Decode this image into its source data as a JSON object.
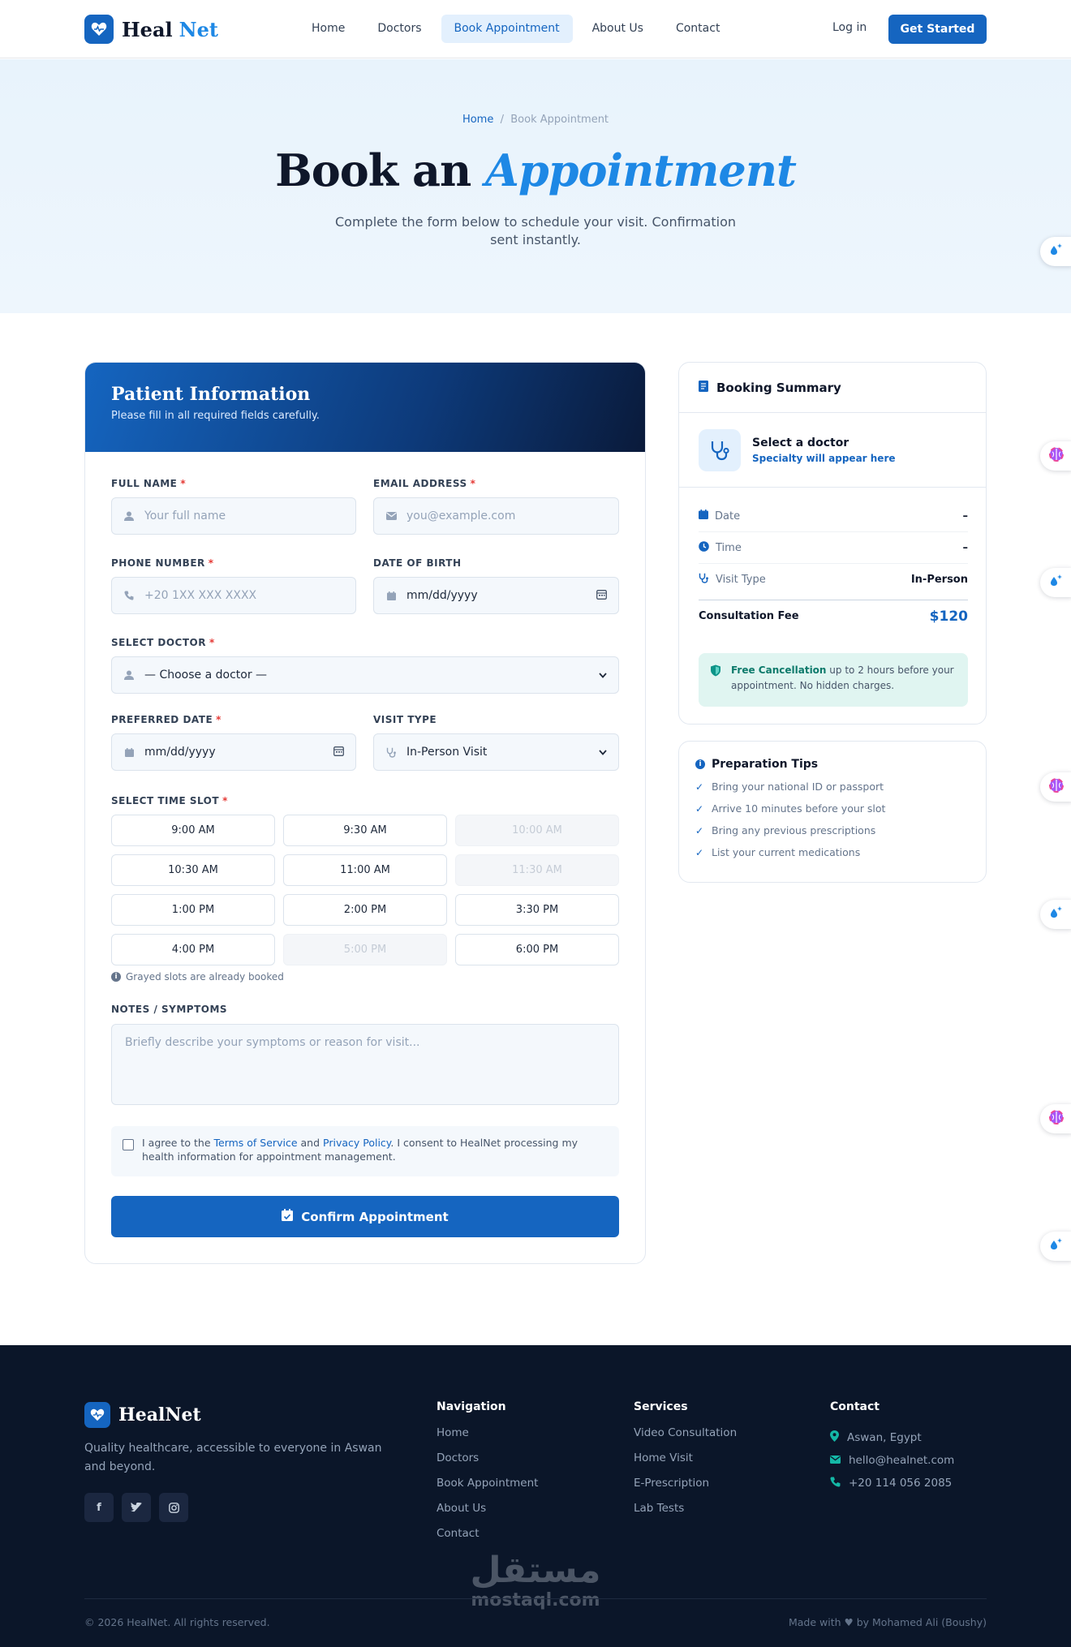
{
  "brand": {
    "name_part1": "Heal",
    "name_part2": "Net",
    "footer_name": "HealNet"
  },
  "nav": {
    "links": [
      "Home",
      "Doctors",
      "Book Appointment",
      "About Us",
      "Contact"
    ],
    "active": "Book Appointment",
    "login": "Log in",
    "cta": "Get Started"
  },
  "hero": {
    "breadcrumb_home": "Home",
    "breadcrumb_sep": "/",
    "breadcrumb_current": "Book Appointment",
    "title_part1": "Book an",
    "title_part2": "Appointment",
    "subtitle": "Complete the form below to schedule your visit. Confirmation sent instantly."
  },
  "form": {
    "title": "Patient Information",
    "subtitle": "Please fill in all required fields carefully.",
    "full_name": {
      "label": "FULL NAME",
      "placeholder": "Your full name"
    },
    "email": {
      "label": "EMAIL ADDRESS",
      "placeholder": "you@example.com"
    },
    "phone": {
      "label": "PHONE NUMBER",
      "placeholder": "+20 1XX XXX XXXX"
    },
    "dob": {
      "label": "DATE OF BIRTH",
      "placeholder": "mm/dd/yyyy"
    },
    "doctor": {
      "label": "SELECT DOCTOR",
      "value": "— Choose a doctor —"
    },
    "pref_date": {
      "label": "PREFERRED DATE",
      "placeholder": "mm/dd/yyyy"
    },
    "visit_type": {
      "label": "VISIT TYPE",
      "value": "In-Person Visit"
    },
    "time_slot_label": "SELECT TIME SLOT",
    "slots": [
      {
        "time": "9:00 AM",
        "booked": false
      },
      {
        "time": "9:30 AM",
        "booked": false
      },
      {
        "time": "10:00 AM",
        "booked": true
      },
      {
        "time": "10:30 AM",
        "booked": false
      },
      {
        "time": "11:00 AM",
        "booked": false
      },
      {
        "time": "11:30 AM",
        "booked": true
      },
      {
        "time": "1:00 PM",
        "booked": false
      },
      {
        "time": "2:00 PM",
        "booked": false
      },
      {
        "time": "3:30 PM",
        "booked": false
      },
      {
        "time": "4:00 PM",
        "booked": false
      },
      {
        "time": "5:00 PM",
        "booked": true
      },
      {
        "time": "6:00 PM",
        "booked": false
      }
    ],
    "slot_hint": "Grayed slots are already booked",
    "notes": {
      "label": "NOTES / SYMPTOMS",
      "placeholder": "Briefly describe your symptoms or reason for visit..."
    },
    "consent": {
      "prefix": "I agree to the",
      "terms": "Terms of Service",
      "and": "and",
      "privacy": "Privacy Policy",
      "suffix": ". I consent to HealNet processing my health information for appointment management."
    },
    "submit": "Confirm Appointment",
    "required_mark": "*"
  },
  "summary": {
    "title": "Booking Summary",
    "doctor_name": "Select a doctor",
    "doctor_specialty": "Specialty will appear here",
    "rows": [
      {
        "label": "Date",
        "value": "–"
      },
      {
        "label": "Time",
        "value": "–"
      },
      {
        "label": "Visit Type",
        "value": "In-Person"
      }
    ],
    "fee_label": "Consultation Fee",
    "fee_value": "$120",
    "cancel_bold": "Free Cancellation",
    "cancel_text": "up to 2 hours before your appointment. No hidden charges."
  },
  "tips": {
    "title": "Preparation Tips",
    "items": [
      "Bring your national ID or passport",
      "Arrive 10 minutes before your slot",
      "Bring any previous prescriptions",
      "List your current medications"
    ]
  },
  "footer": {
    "description": "Quality healthcare, accessible to everyone in Aswan and beyond.",
    "social": [
      "f",
      "t",
      "ig"
    ],
    "navigation": {
      "title": "Navigation",
      "items": [
        "Home",
        "Doctors",
        "Book Appointment",
        "About Us",
        "Contact"
      ]
    },
    "services": {
      "title": "Services",
      "items": [
        "Video Consultation",
        "Home Visit",
        "E-Prescription",
        "Lab Tests"
      ]
    },
    "contact": {
      "title": "Contact",
      "items": [
        "Aswan, Egypt",
        "hello@healnet.com",
        "+20 114 056 2085"
      ]
    },
    "copyright": "© 2026 HealNet. All rights reserved.",
    "made_by": "Made with ♥ by Mohamed Ali (Boushy)",
    "watermark_ar": "مستقل",
    "watermark_en": "mostaql.com"
  },
  "colors": {
    "primary": "#1565c0",
    "accent": "#1e88e5",
    "footer_bg": "#0b1629",
    "required": "#e53935"
  }
}
